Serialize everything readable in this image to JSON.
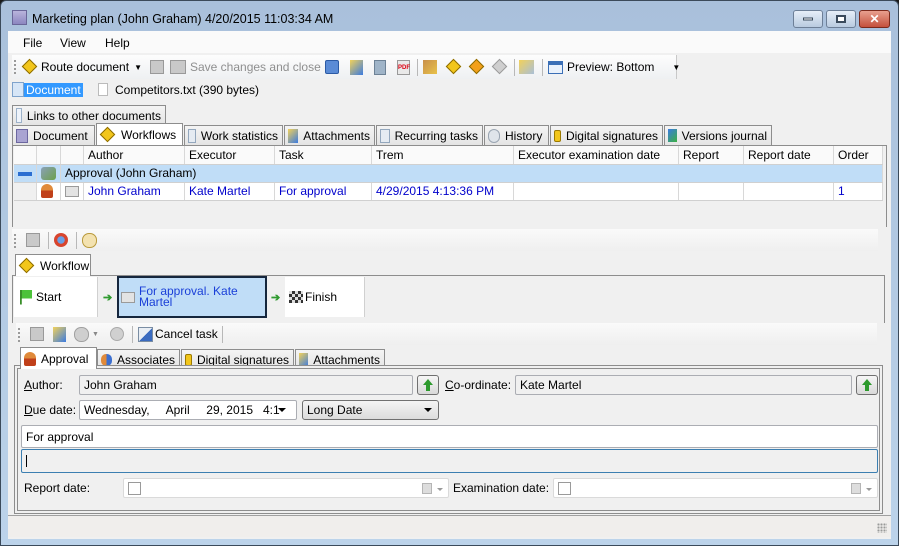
{
  "window": {
    "title": "Marketing plan (John Graham) 4/20/2015 11:03:34 AM",
    "controls": [
      "minimize",
      "maximize",
      "close"
    ]
  },
  "menu": [
    "File",
    "View",
    "Help"
  ],
  "toolbar": {
    "route_document": "Route document",
    "save_changes_close": "Save changes and close",
    "preview": "Preview: Bottom"
  },
  "document_chips": {
    "document": "Document",
    "attachment": "Competitors.txt (390 bytes)"
  },
  "outer_tabs": {
    "top_row": [
      "Links to other documents"
    ],
    "bottom_row": [
      "Document",
      "Workflows",
      "Work statistics",
      "Attachments",
      "Recurring tasks",
      "History",
      "Digital signatures",
      "Versions journal"
    ],
    "active": "Workflows"
  },
  "grid": {
    "columns": [
      "Author",
      "Executor",
      "Task",
      "Trem",
      "Executor examination date",
      "Report",
      "Report date",
      "Order"
    ],
    "group_label": "Approval (John Graham)",
    "rows": [
      {
        "author": "John Graham",
        "executor": "Kate Martel",
        "task": "For approval",
        "trem": "4/29/2015 4:13:36 PM",
        "exec_exam_date": "",
        "report": "",
        "report_date": "",
        "order": "1"
      }
    ]
  },
  "workflow": {
    "tab_label": "Workflow",
    "steps": [
      "Start",
      "For approval. Kate Martel",
      "Finish"
    ],
    "active_step": "For approval. Kate Martel"
  },
  "task_toolbar": {
    "cancel_task": "Cancel task"
  },
  "inner_tabs": {
    "items": [
      "Approval",
      "Associates",
      "Digital signatures",
      "Attachments"
    ],
    "active": "Approval"
  },
  "form": {
    "author_label": "Author:",
    "author_value": "John Graham",
    "coordinate_label": "Co-ordinate:",
    "coordinate_value": "Kate Martel",
    "due_date_label": "Due date:",
    "due_date_value": "Wednesday,     April     29, 2015   4:1",
    "date_format": "Long Date",
    "task_text": "For approval",
    "comment_value": "",
    "report_date_label": "Report date:",
    "report_date_value": "",
    "examination_date_label": "Examination date:",
    "examination_date_value": ""
  },
  "colors": {
    "selection": "#3399ff",
    "group_row": "#c0ddf7",
    "link_text": "#0000cc",
    "active_step_border": "#15263d"
  }
}
